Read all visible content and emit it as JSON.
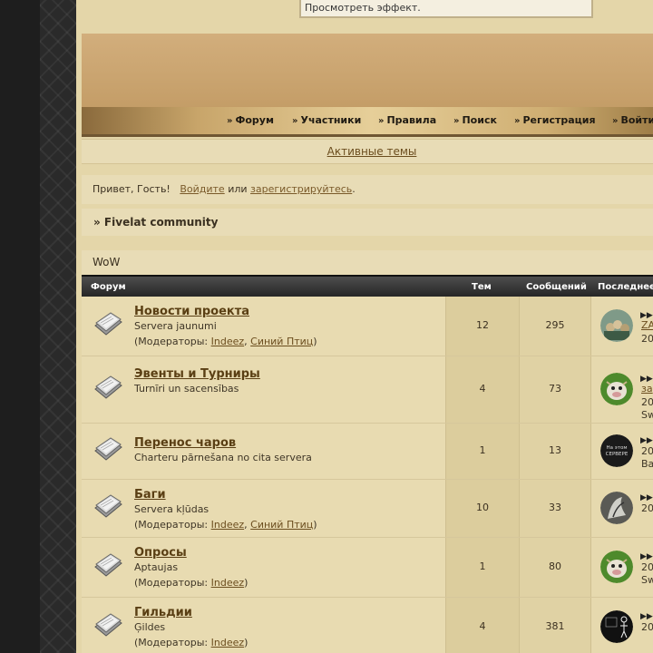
{
  "preview_input": {
    "value": "Просмотреть эффект."
  },
  "nav": {
    "items": [
      {
        "label": "Форум"
      },
      {
        "label": "Участники"
      },
      {
        "label": "Правила"
      },
      {
        "label": "Поиск"
      },
      {
        "label": "Регистрация"
      },
      {
        "label": "Войти"
      }
    ]
  },
  "subbar": {
    "active_topics": "Активные темы"
  },
  "greeting": {
    "hello": "Привет, Гость!",
    "login": "Войдите",
    "or": "или",
    "register": "зарегистрируйтесь",
    "dot": "."
  },
  "breadcrumb": {
    "label": "» Fivelat community"
  },
  "category": {
    "name": "WoW"
  },
  "table": {
    "headers": {
      "forum": "Форум",
      "topics": "Тем",
      "posts": "Сообщений",
      "last": "Последнее"
    },
    "rows": [
      {
        "title": "Новости проекта",
        "desc": "Servera jaunumi",
        "mods_prefix": "(Модераторы: ",
        "mods": [
          "Indeez",
          "Синий Птиц"
        ],
        "mods_suffix": ")",
        "topics": "12",
        "posts": "295",
        "last_line1": "ZA",
        "last_line2": "20",
        "last_line3": ""
      },
      {
        "title": "Эвенты и Турниры",
        "desc": "Turnīri un sacensības",
        "mods_prefix": "",
        "mods": [],
        "mods_suffix": "",
        "topics": "4",
        "posts": "73",
        "last_line1": "за",
        "last_line2": "20",
        "last_line3": "Sw"
      },
      {
        "title": "Перенос чаров",
        "desc": "Charteru pārnešana no cita servera",
        "mods_prefix": "",
        "mods": [],
        "mods_suffix": "",
        "topics": "1",
        "posts": "13",
        "last_line1": "",
        "last_line2": "20",
        "last_line3": "Ba"
      },
      {
        "title": "Баги",
        "desc": "Servera kļūdas",
        "mods_prefix": "(Модераторы: ",
        "mods": [
          "Indeez",
          "Синий Птиц"
        ],
        "mods_suffix": ")",
        "topics": "10",
        "posts": "33",
        "last_line1": "",
        "last_line2": "20",
        "last_line3": ""
      },
      {
        "title": "Опросы",
        "desc": "Aptaujas",
        "mods_prefix": "(Модераторы: ",
        "mods": [
          "Indeez"
        ],
        "mods_suffix": ")",
        "topics": "1",
        "posts": "80",
        "last_line1": "",
        "last_line2": "20",
        "last_line3": "Sw"
      },
      {
        "title": "Гильдии",
        "desc": "Ģildes",
        "mods_prefix": "(Модераторы: ",
        "mods": [
          "Indeez"
        ],
        "mods_suffix": ")",
        "topics": "4",
        "posts": "381",
        "last_line1": "",
        "last_line2": "20",
        "last_line3": ""
      }
    ]
  },
  "avatars": [
    {
      "kind": "group-photo",
      "bg": "#7f9a88"
    },
    {
      "kind": "cow",
      "bg": "#4e8a2c"
    },
    {
      "kind": "text",
      "bg": "#1a1a1a",
      "text1": "На этом",
      "text2": "СЕРВЕРЕ"
    },
    {
      "kind": "creature",
      "bg": "#5a5a55"
    },
    {
      "kind": "cow",
      "bg": "#4e8a2c"
    },
    {
      "kind": "stickman",
      "bg": "#111111"
    }
  ]
}
